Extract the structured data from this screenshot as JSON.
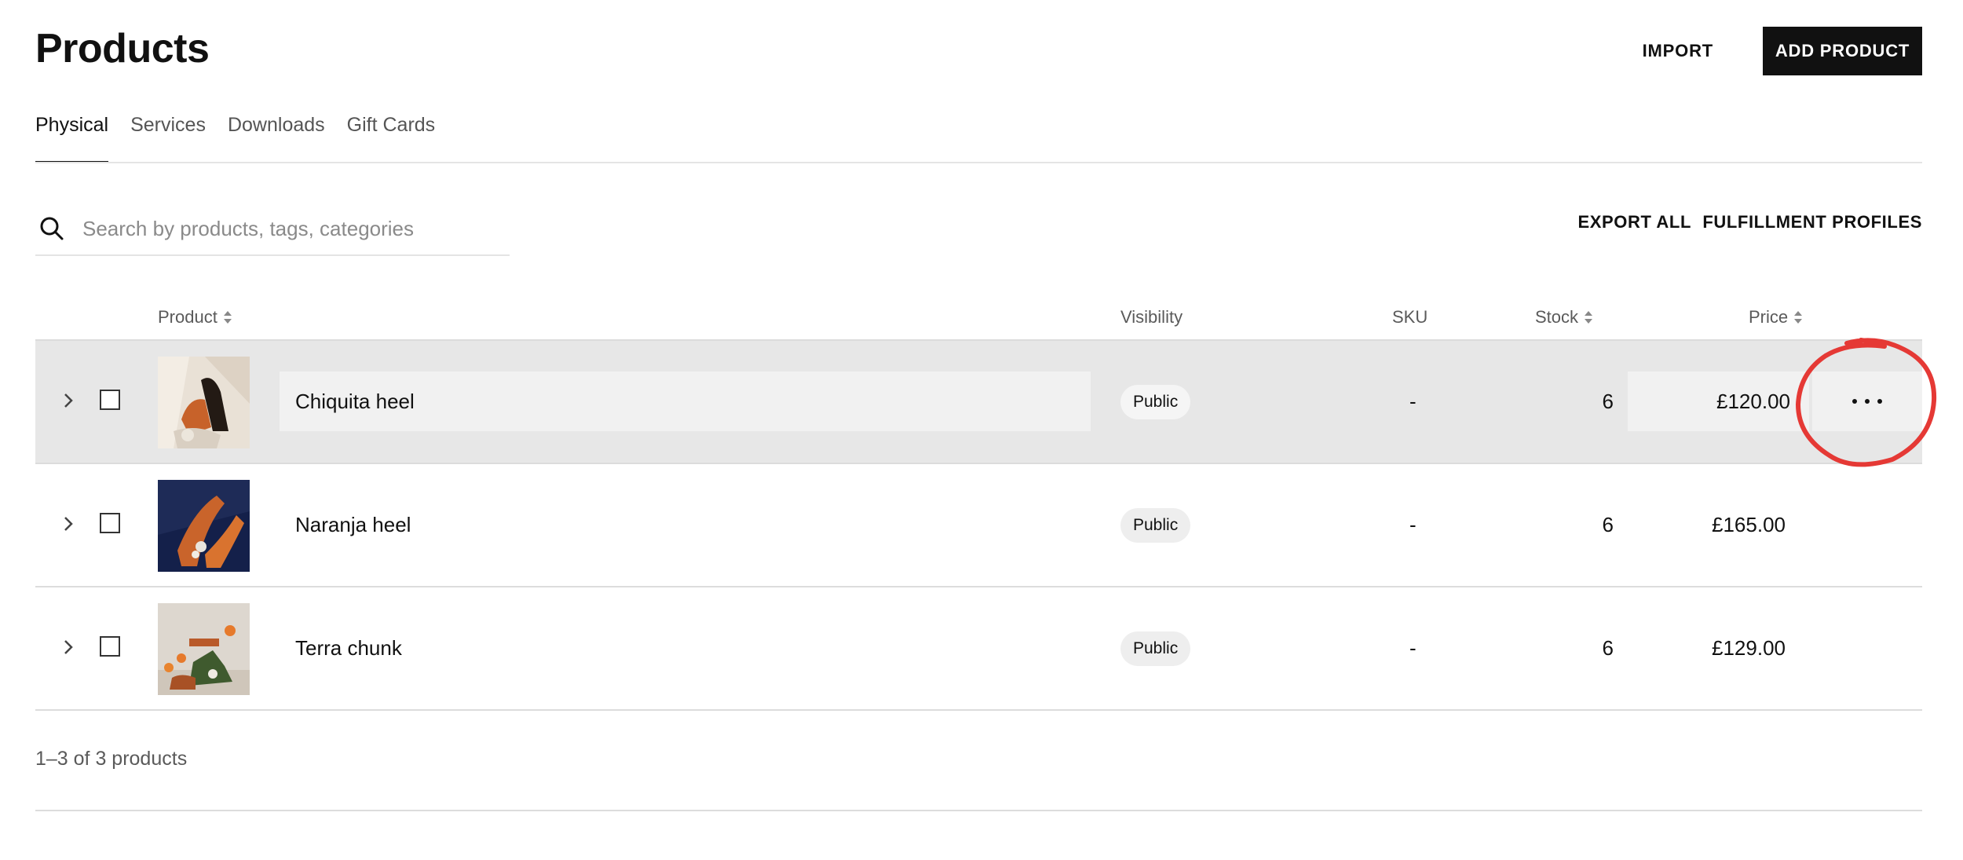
{
  "header": {
    "title": "Products",
    "import_label": "IMPORT",
    "add_label": "ADD PRODUCT"
  },
  "tabs": [
    {
      "label": "Physical",
      "active": true
    },
    {
      "label": "Services",
      "active": false
    },
    {
      "label": "Downloads",
      "active": false
    },
    {
      "label": "Gift Cards",
      "active": false
    }
  ],
  "search": {
    "placeholder": "Search by products, tags, categories",
    "icon": "search-icon"
  },
  "actions": {
    "export_label": "EXPORT ALL",
    "fulfillment_label": "FULFILLMENT PROFILES"
  },
  "table": {
    "columns": {
      "product": "Product",
      "visibility": "Visibility",
      "sku": "SKU",
      "stock": "Stock",
      "price": "Price"
    },
    "rows": [
      {
        "name": "Chiquita heel",
        "visibility": "Public",
        "sku": "-",
        "stock": "6",
        "price": "£120.00",
        "hovered": true
      },
      {
        "name": "Naranja heel",
        "visibility": "Public",
        "sku": "-",
        "stock": "6",
        "price": "£165.00",
        "hovered": false
      },
      {
        "name": "Terra chunk",
        "visibility": "Public",
        "sku": "-",
        "stock": "6",
        "price": "£129.00",
        "hovered": false
      }
    ]
  },
  "pagination": {
    "text": "1–3 of 3 products"
  },
  "colors": {
    "primary_button": "#111111",
    "hover_row": "#e7e7e7",
    "annotation": "#e53935"
  }
}
